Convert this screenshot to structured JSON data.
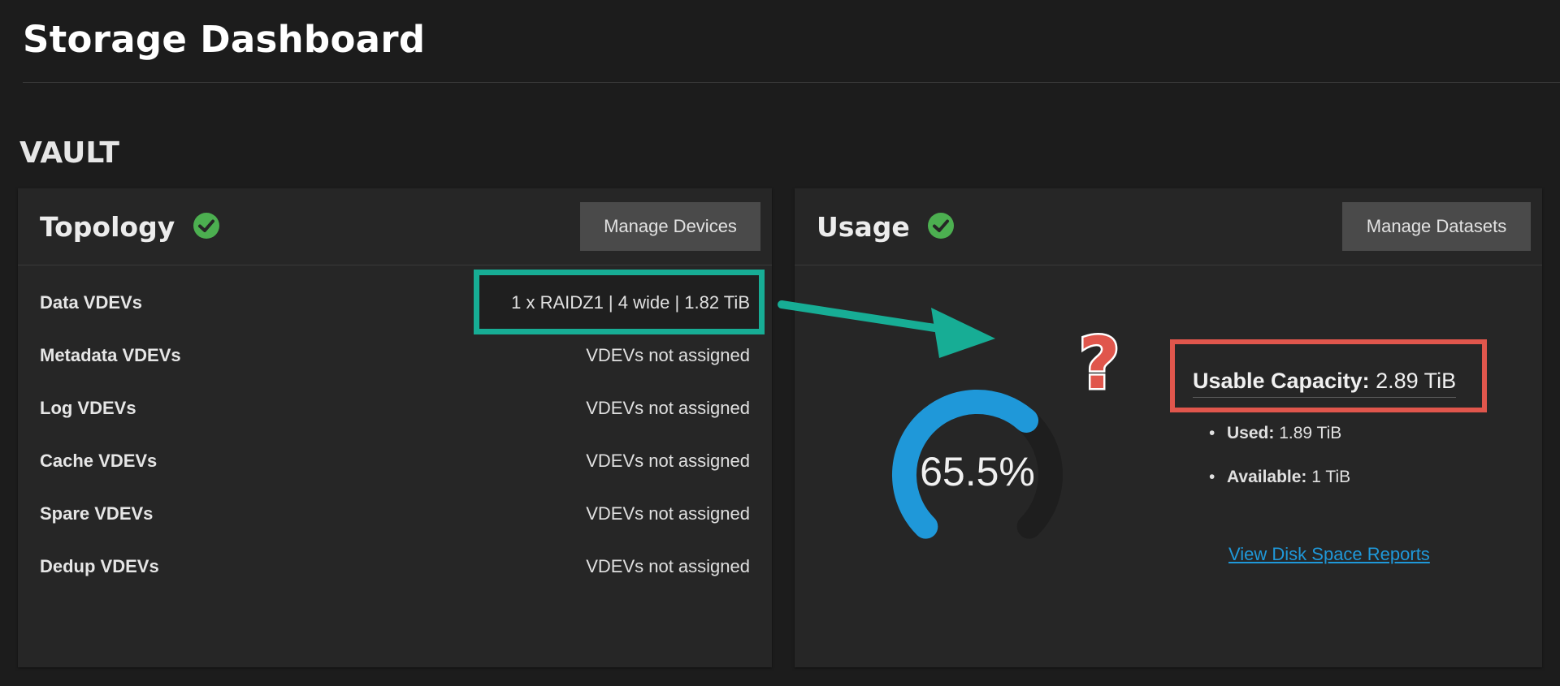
{
  "header": {
    "title": "Storage Dashboard"
  },
  "pool": {
    "name": "VAULT"
  },
  "topology": {
    "title": "Topology",
    "button_label": "Manage Devices",
    "rows": [
      {
        "label": "Data VDEVs",
        "value": "1 x RAIDZ1 | 4 wide | 1.82 TiB"
      },
      {
        "label": "Metadata VDEVs",
        "value": "VDEVs not assigned"
      },
      {
        "label": "Log VDEVs",
        "value": "VDEVs not assigned"
      },
      {
        "label": "Cache VDEVs",
        "value": "VDEVs not assigned"
      },
      {
        "label": "Spare VDEVs",
        "value": "VDEVs not assigned"
      },
      {
        "label": "Dedup VDEVs",
        "value": "VDEVs not assigned"
      }
    ]
  },
  "usage": {
    "title": "Usage",
    "button_label": "Manage Datasets",
    "percent_text": "65.5%",
    "percent_value": 65.5,
    "usable_capacity_label": "Usable Capacity:",
    "usable_capacity_value": "2.89 TiB",
    "used_label": "Used:",
    "used_value": "1.89 TiB",
    "available_label": "Available:",
    "available_value": "1 TiB",
    "link_label": "View Disk Space Reports"
  },
  "annotations": {
    "question_mark": "?"
  },
  "colors": {
    "status_ok": "#4caf50",
    "gauge_fill": "#1f98d9",
    "gauge_track": "#1e1e1e",
    "highlight_teal": "#17ad95",
    "highlight_red": "#e0564c",
    "link": "#1f98d9"
  }
}
